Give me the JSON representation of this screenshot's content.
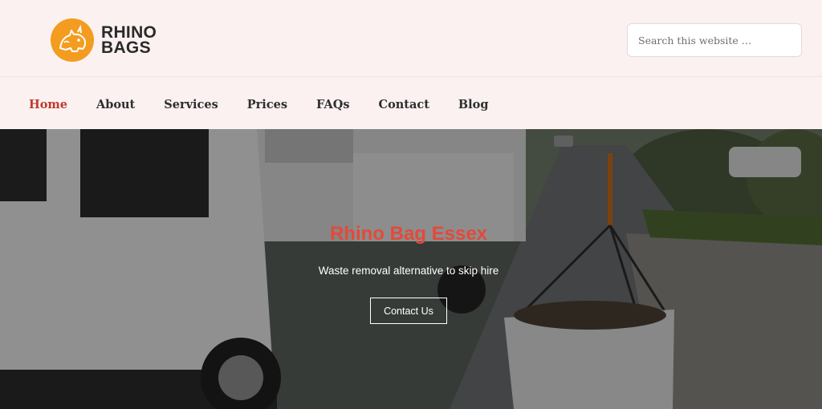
{
  "brand": {
    "line1": "RHINO",
    "line2": "BAGS",
    "accent_color": "#f39c1f"
  },
  "search": {
    "placeholder": "Search this website …",
    "value": ""
  },
  "nav": {
    "items": [
      {
        "label": "Home",
        "active": true
      },
      {
        "label": "About"
      },
      {
        "label": "Services"
      },
      {
        "label": "Prices"
      },
      {
        "label": "FAQs"
      },
      {
        "label": "Contact"
      },
      {
        "label": "Blog"
      }
    ],
    "active_color": "#c0392b"
  },
  "hero": {
    "title": "Rhino Bag Essex",
    "subtitle": "Waste removal alternative to skip hire",
    "cta_label": "Contact Us",
    "title_color": "#e24a3b"
  }
}
